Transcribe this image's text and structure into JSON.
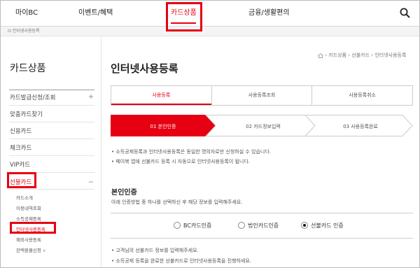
{
  "gnb": {
    "items": [
      {
        "label": "마이BC"
      },
      {
        "label": "이벤트/혜택"
      },
      {
        "label": "카드상품"
      },
      {
        "label": "금융/생활편의"
      }
    ],
    "search_icon": "search-icon"
  },
  "breadcrumb_bar": {
    "text": "⊡ 인터넷사용등록"
  },
  "sidebar": {
    "title": "카드상품",
    "items": [
      {
        "label": "카드발급신청/조회"
      },
      {
        "label": "맞춤카드찾기"
      },
      {
        "label": "신용카드"
      },
      {
        "label": "체크카드"
      },
      {
        "label": "VIP카드"
      },
      {
        "label": "선불카드"
      }
    ],
    "sub_items": [
      {
        "label": "카드소개"
      },
      {
        "label": "이용내역조회"
      },
      {
        "label": "소득공제등록"
      },
      {
        "label": "인터넷사용등록"
      },
      {
        "label": "해외사용등록"
      },
      {
        "label": "잔액환불신청"
      }
    ]
  },
  "main": {
    "title": "인터넷사용등록",
    "location": {
      "l1": "카드상품",
      "l2": "선불카드",
      "l3": "인터넷사용등록"
    },
    "tabs": [
      {
        "label": "사용등록"
      },
      {
        "label": "사용등록조회"
      },
      {
        "label": "사용등록취소"
      }
    ],
    "steps": [
      {
        "label": "01 본인인증"
      },
      {
        "label": "02 카드정보입력"
      },
      {
        "label": "03 사용등록완료"
      }
    ],
    "notes": [
      "• 소득공제등록과 인터넷사용등록은 동일한 명의자로만 신청하실 수 있습니다.",
      "• 페이북 앱에 선불카드 등록 시 자동으로 인터넷사용등록이 됩니다."
    ],
    "auth_title": "본인인증",
    "auth_desc": "아래 인증방법 중 하나를 선택하신 후 해당 정보를 입력해주세요.",
    "radios": [
      {
        "label": "BC카드인증"
      },
      {
        "label": "법인카드인증"
      },
      {
        "label": "선불카드 인증"
      }
    ],
    "bottom_notes": [
      "• 고객님의 선불카드 정보를 입력해주세요.",
      "• 소득공제 등록을 완료한 선불카드로 인터넷사용등록을 진행하세요."
    ]
  },
  "colors": {
    "accent": "#e60012",
    "border": "#cccccc"
  }
}
